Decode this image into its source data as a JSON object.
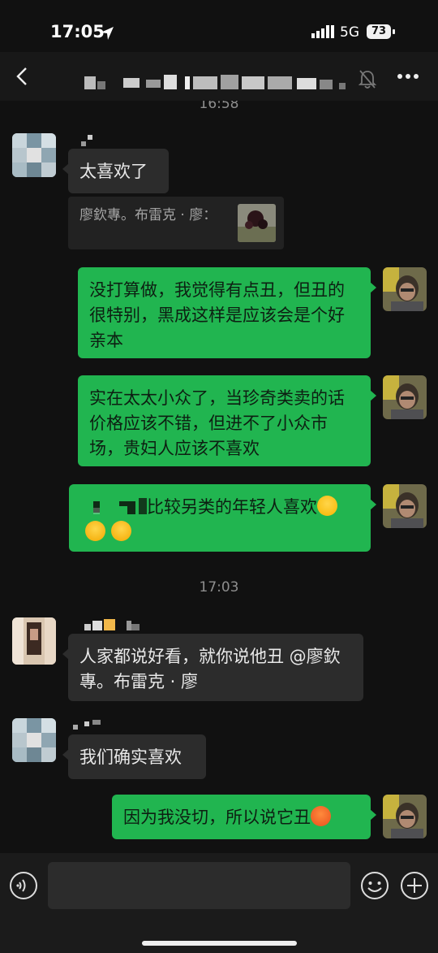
{
  "status_bar": {
    "time": "17:05",
    "network": "5G",
    "battery": "73"
  },
  "header": {
    "icons": [
      "back-chevron-icon",
      "mute-bell-icon",
      "more-dots-icon"
    ]
  },
  "messages": {
    "ts1": "16:58",
    "m1": "太喜欢了",
    "q1": "廖欽專。布雷克 · 廖：",
    "m2": "没打算做，我觉得有点丑，但丑的很特别，黑成这样是应该会是个好亲本",
    "m3": "实在太太小众了，当珍奇类卖的话价格应该不错，但进不了小众市场，贵妇人应该不喜欢",
    "m4": "比较另类的年轻人喜欢",
    "ts2": "17:03",
    "m5": "人家都说好看，就你说他丑 @廖欽專。布雷克 · 廖",
    "m6": "我们确实喜欢",
    "m7": "因为我没切，所以说它丑"
  },
  "input_bar": {
    "icons": [
      "voice-icon",
      "emoji-icon",
      "plus-icon"
    ]
  },
  "colors": {
    "outgoing_bubble": "#21b550",
    "incoming_bubble": "#2c2c2c",
    "background": "#111111"
  }
}
